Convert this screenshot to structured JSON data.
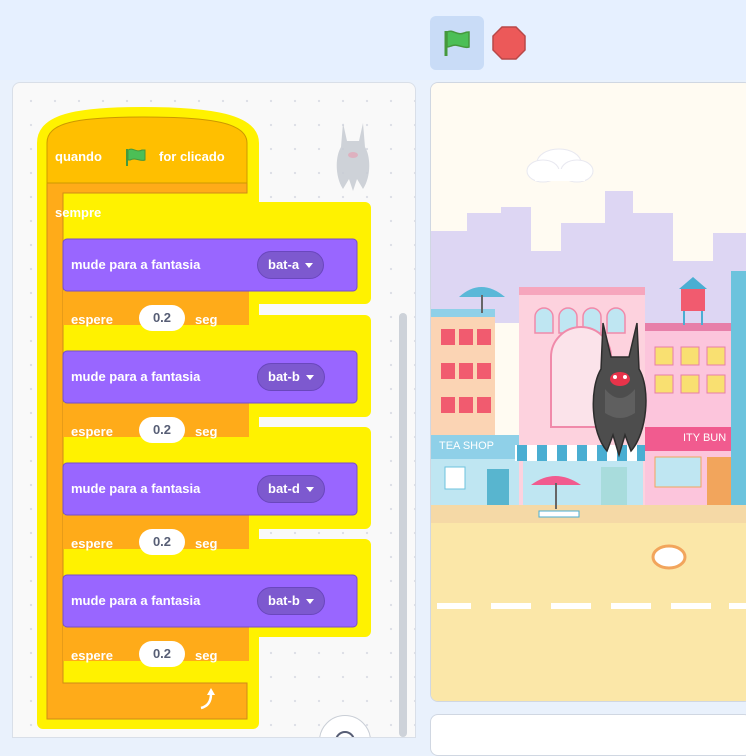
{
  "toolbar": {
    "green_flag_icon": "green-flag",
    "stop_icon": "stop-sign"
  },
  "script": {
    "hat_label_1": "quando",
    "hat_label_2": "for clicado",
    "forever_label": "sempre",
    "costume_label": "mude para a fantasia",
    "wait_label": "espere",
    "wait_unit": "seg",
    "steps": [
      {
        "costume": "bat-a",
        "wait": "0.2"
      },
      {
        "costume": "bat-b",
        "wait": "0.2"
      },
      {
        "costume": "bat-d",
        "wait": "0.2"
      },
      {
        "costume": "bat-b",
        "wait": "0.2"
      }
    ]
  },
  "stage": {
    "sign_tea_shop": "TEA SHOP",
    "sign_bun": "ITY BUN"
  },
  "colors": {
    "events": "#ffbf00",
    "control": "#ffab19",
    "looks": "#9966ff",
    "highlight": "#fff200"
  }
}
